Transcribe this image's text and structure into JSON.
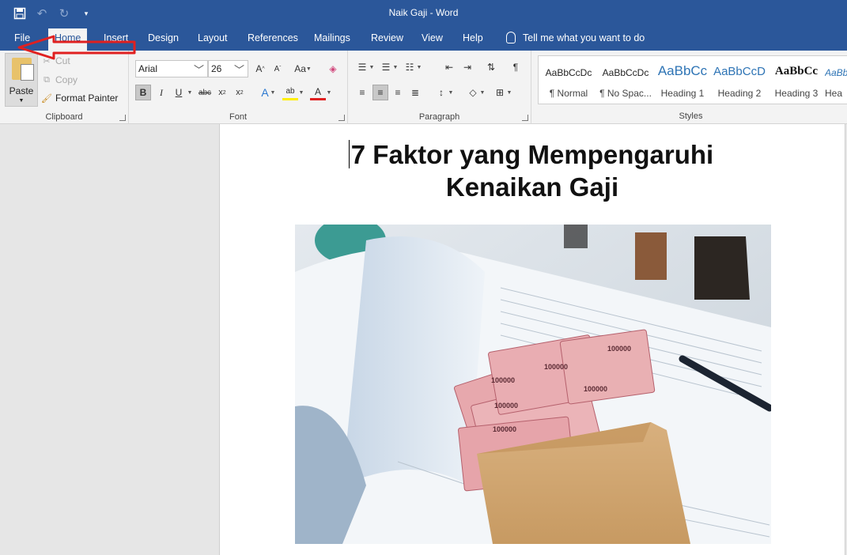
{
  "titlebar": {
    "title": "Naik Gaji  -  Word"
  },
  "tabs": [
    "File",
    "Home",
    "Insert",
    "Design",
    "Layout",
    "References",
    "Mailings",
    "Review",
    "View",
    "Help"
  ],
  "tell_me": "Tell me what you want to do",
  "clipboard": {
    "paste": "Paste",
    "cut": "Cut",
    "copy": "Copy",
    "format_painter": "Format Painter",
    "label": "Clipboard"
  },
  "font": {
    "name": "Arial",
    "size": "26",
    "label": "Font"
  },
  "paragraph": {
    "label": "Paragraph"
  },
  "styles": {
    "label": "Styles",
    "items": [
      {
        "sample": "AaBbCcDc",
        "name": "¶ Normal"
      },
      {
        "sample": "AaBbCcDc",
        "name": "¶ No Spac..."
      },
      {
        "sample": "AaBbCc",
        "name": "Heading 1"
      },
      {
        "sample": "AaBbCcD",
        "name": "Heading 2"
      },
      {
        "sample": "AaBbCc",
        "name": "Heading 3"
      },
      {
        "sample": "AaBb",
        "name": "Hea"
      }
    ]
  },
  "document": {
    "heading_line1": "7 Faktor yang Mempengaruhi",
    "heading_line2": "Kenaikan Gaji"
  },
  "money_label": "100000",
  "colors": {
    "accent": "#2b579a",
    "annotation_arrow": "#e02020",
    "heading1": "#2e74b5",
    "heading2": "#2e74b5",
    "heading3": "#1f3763"
  },
  "icons": [
    "save-icon",
    "undo-icon",
    "redo-icon",
    "customize-qat-icon",
    "lightbulb-icon",
    "scissors-icon",
    "copy-icon",
    "format-painter-icon"
  ]
}
